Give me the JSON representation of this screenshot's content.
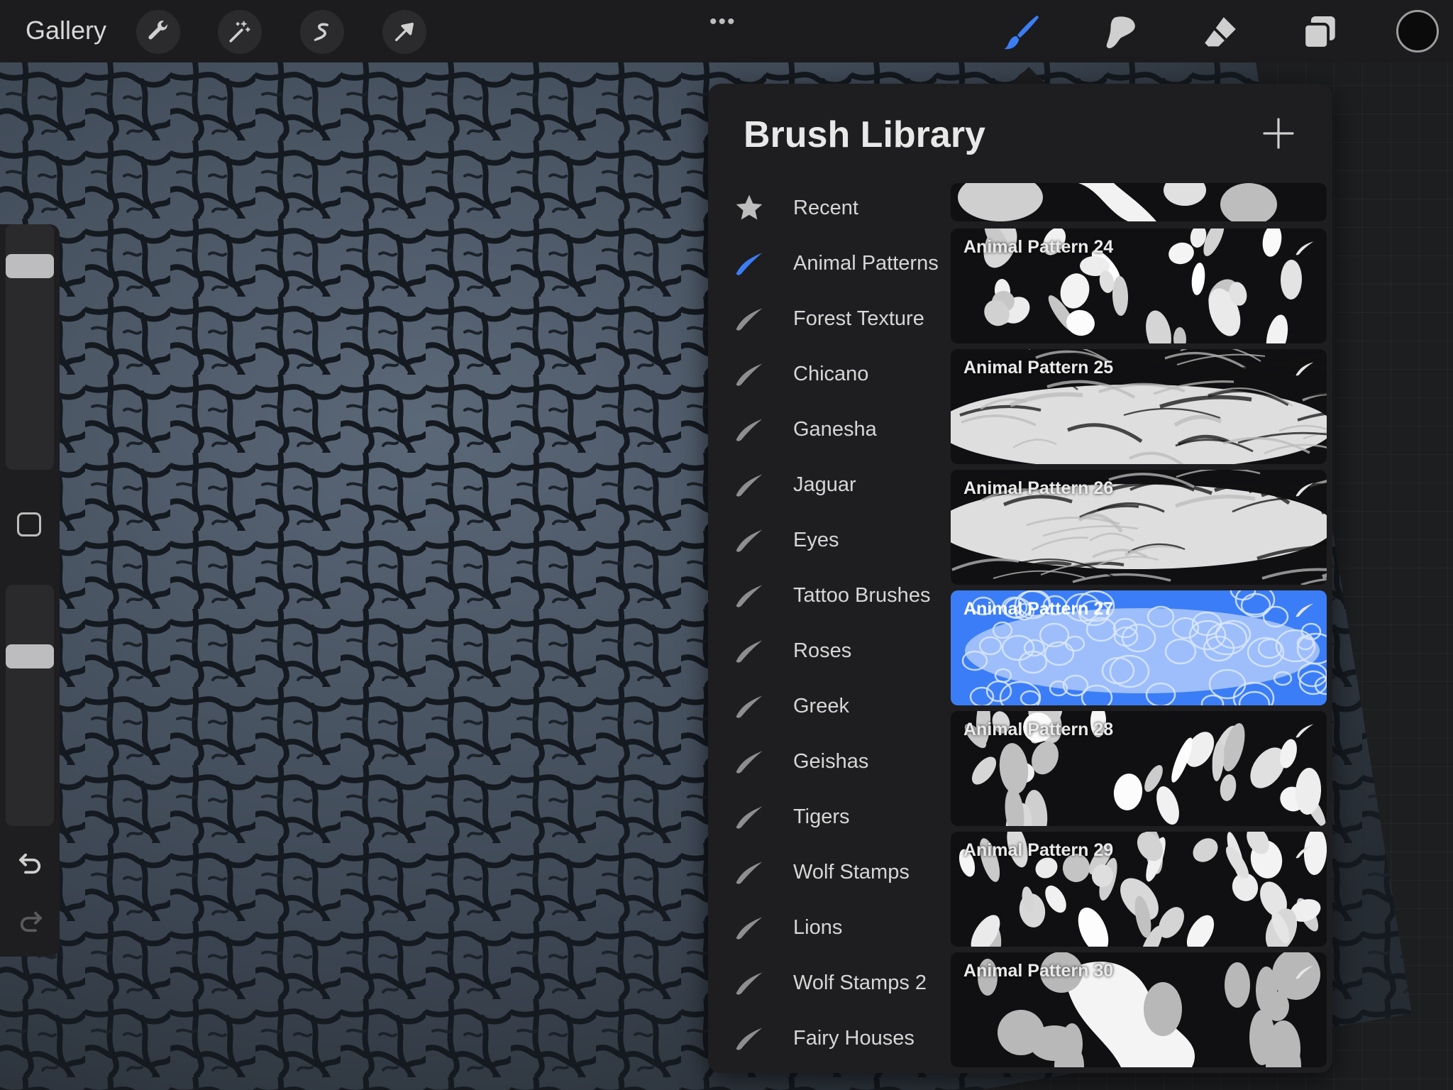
{
  "topbar": {
    "gallery_label": "Gallery",
    "more_label": "•••",
    "tools": [
      "wrench-icon",
      "magic-wand-icon",
      "selection-icon",
      "transform-arrow-icon"
    ],
    "right_tools": [
      "brush-icon",
      "smudge-icon",
      "eraser-icon",
      "layers-icon"
    ],
    "current_color": "#0b0b0c",
    "accent": "#3b7df6"
  },
  "panel": {
    "title": "Brush Library",
    "add_icon": "plus-icon",
    "categories": [
      {
        "label": "Recent",
        "icon": "star-icon"
      },
      {
        "label": "Animal Patterns",
        "icon": "brush-stroke-icon",
        "active": true
      },
      {
        "label": "Forest Texture",
        "icon": "brush-stroke-icon"
      },
      {
        "label": "Chicano",
        "icon": "brush-stroke-icon"
      },
      {
        "label": "Ganesha",
        "icon": "brush-stroke-icon"
      },
      {
        "label": "Jaguar",
        "icon": "brush-stroke-icon"
      },
      {
        "label": "Eyes",
        "icon": "brush-stroke-icon"
      },
      {
        "label": "Tattoo Brushes",
        "icon": "brush-stroke-icon"
      },
      {
        "label": "Roses",
        "icon": "brush-stroke-icon"
      },
      {
        "label": "Greek",
        "icon": "brush-stroke-icon"
      },
      {
        "label": "Geishas",
        "icon": "brush-stroke-icon"
      },
      {
        "label": "Tigers",
        "icon": "brush-stroke-icon"
      },
      {
        "label": "Wolf Stamps",
        "icon": "brush-stroke-icon"
      },
      {
        "label": "Lions",
        "icon": "brush-stroke-icon"
      },
      {
        "label": "Wolf Stamps 2",
        "icon": "brush-stroke-icon"
      },
      {
        "label": "Fairy Houses",
        "icon": "brush-stroke-icon"
      }
    ],
    "brushes": [
      {
        "name": "Animal Pattern 24"
      },
      {
        "name": "Animal Pattern 25"
      },
      {
        "name": "Animal Pattern 26"
      },
      {
        "name": "Animal Pattern 27",
        "selected": true
      },
      {
        "name": "Animal Pattern 28"
      },
      {
        "name": "Animal Pattern 29"
      },
      {
        "name": "Animal Pattern 30"
      }
    ]
  }
}
